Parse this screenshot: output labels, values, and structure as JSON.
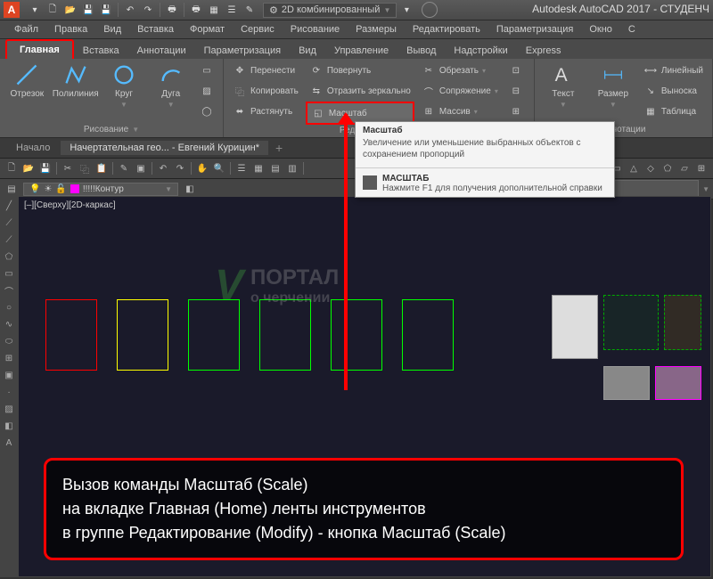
{
  "app": {
    "title": "Autodesk AutoCAD 2017 - СТУДЕНЧ",
    "logo": "A"
  },
  "qat": {
    "workspace": "2D комбинированный"
  },
  "menu": [
    "Файл",
    "Правка",
    "Вид",
    "Вставка",
    "Формат",
    "Сервис",
    "Рисование",
    "Размеры",
    "Редактировать",
    "Параметризация",
    "Окно",
    "С"
  ],
  "tabs": [
    "Главная",
    "Вставка",
    "Аннотации",
    "Параметризация",
    "Вид",
    "Управление",
    "Вывод",
    "Надстройки",
    "Express"
  ],
  "active_tab": 0,
  "ribbon": {
    "draw": {
      "title": "Рисование",
      "line": "Отрезок",
      "pline": "Полилиния",
      "circle": "Круг",
      "arc": "Дуга"
    },
    "modify": {
      "title": "Редактирование",
      "move": "Перенести",
      "copy": "Копировать",
      "stretch": "Растянуть",
      "rotate": "Повернуть",
      "mirror": "Отразить зеркально",
      "scale": "Масштаб",
      "trim": "Обрезать",
      "fillet": "Сопряжение",
      "array": "Массив"
    },
    "annot": {
      "title": "Аннотации",
      "text": "Текст",
      "dim": "Размер",
      "linear": "Линейный",
      "leader": "Выноска",
      "table": "Таблица"
    }
  },
  "filetabs": {
    "start": "Начало",
    "doc": "Начертательная гео... - Евгений Курицин*"
  },
  "layer": {
    "current": "!!!!!Контур"
  },
  "viewport": {
    "label": "[–][Сверху][2D-каркас]"
  },
  "tooltip": {
    "title": "Масштаб",
    "body": "Увеличение или уменьшение выбранных объектов с сохранением пропорций",
    "cmd": "МАСШТАБ",
    "help": "Нажмите F1 для получения дополнительной справки"
  },
  "watermark": {
    "line1": "ПОРТАЛ",
    "line2": "о черчении"
  },
  "callout": {
    "l1": "Вызов команды Масштаб (Scale)",
    "l2": "на вкладке Главная (Home) ленты инструментов",
    "l3": "в группе Редактирование (Modify) - кнопка Масштаб (Scale)"
  }
}
